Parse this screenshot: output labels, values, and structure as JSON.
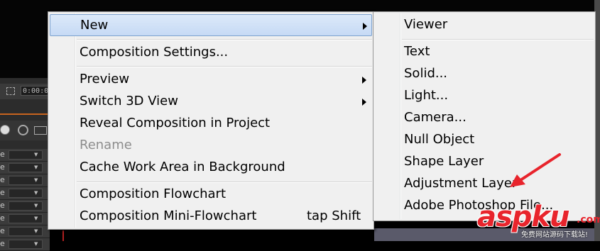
{
  "background": {
    "timecode": "0:00:0",
    "row_labels": [
      "e",
      "e",
      "e",
      "e",
      "e",
      "e",
      "e",
      "e"
    ]
  },
  "context_menu": {
    "items": [
      {
        "label": "New",
        "has_submenu": true,
        "highlighted": true
      },
      {
        "label": "Composition Settings..."
      },
      {
        "label": "Preview",
        "has_submenu": true
      },
      {
        "label": "Switch 3D View",
        "has_submenu": true
      },
      {
        "label": "Reveal Composition in Project"
      },
      {
        "label": "Rename",
        "disabled": true
      },
      {
        "label": "Cache Work Area in Background"
      },
      {
        "label": "Composition Flowchart"
      },
      {
        "label": "Composition Mini-Flowchart",
        "shortcut": "tap Shift"
      }
    ]
  },
  "new_submenu": {
    "items": [
      {
        "label": "Viewer"
      },
      {
        "label": "Text"
      },
      {
        "label": "Solid..."
      },
      {
        "label": "Light..."
      },
      {
        "label": "Camera..."
      },
      {
        "label": "Null Object"
      },
      {
        "label": "Shape Layer"
      },
      {
        "label": "Adjustment Layer"
      },
      {
        "label": "Adobe Photoshop File..."
      }
    ]
  },
  "annotation": {
    "arrow_color": "#e8242c",
    "icon": "red-pointer-arrow"
  },
  "watermark": {
    "logo": "aspku",
    "domain": ".com",
    "tagline": "免费网站源码下载站!",
    "color": "#e8242c"
  }
}
